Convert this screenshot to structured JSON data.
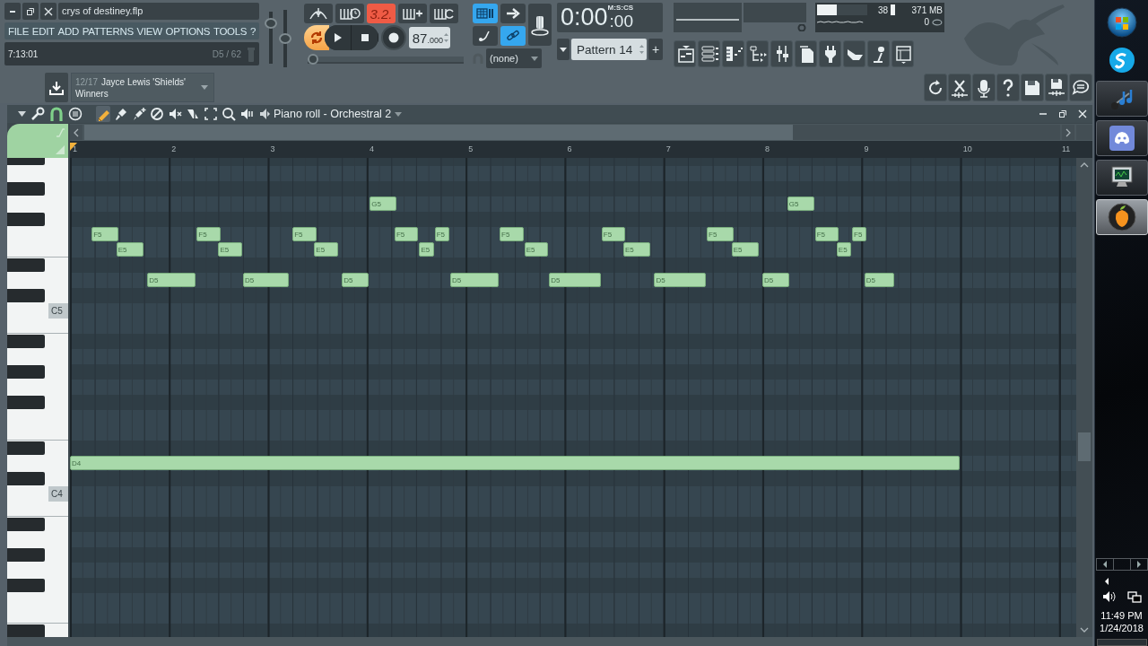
{
  "window": {
    "title": "crys of destiney.flp"
  },
  "menu": [
    "FILE",
    "EDIT",
    "ADD",
    "PATTERNS",
    "VIEW",
    "OPTIONS",
    "TOOLS",
    "?"
  ],
  "hint_bar": {
    "time": "7:13:01",
    "note": "D5 / 62"
  },
  "master": {
    "volume": {
      "level": 0.85
    },
    "pitch": {
      "level": 0.5
    }
  },
  "transport": {
    "countdown": "3.2.",
    "countdown_on": true,
    "loop_on": true,
    "tempo": "87",
    "tempo_fraction": ".000",
    "position": {
      "level": 0
    }
  },
  "snap_controls": {
    "step_edit_on": true,
    "link_on": true,
    "snap": "(none)"
  },
  "time_display": {
    "value": "0:00",
    "fraction": ":00",
    "format": "M:S:CS"
  },
  "pattern": {
    "name": "Pattern 14",
    "add": "+"
  },
  "monitor": {
    "cpu": "38",
    "cpu_meter": {
      "level": 0.4
    },
    "memory": "371 MB",
    "polyphony": "0"
  },
  "news": {
    "count": "12/17",
    "title": "Jayce Lewis 'Shields'",
    "subtitle": "Winners"
  },
  "piano_roll": {
    "title": "Piano roll - Orchestral 2",
    "snap_on": true,
    "tools": [
      {
        "selected": true
      },
      {
        "selected": false
      },
      {
        "selected": false
      },
      {
        "selected": false
      },
      {
        "selected": false
      },
      {
        "selected": false
      },
      {
        "selected": false
      },
      {
        "selected": false
      },
      {
        "selected": false
      }
    ],
    "bars": [
      "1",
      "2",
      "3",
      "4",
      "5",
      "6",
      "7",
      "8",
      "9",
      "10",
      "11"
    ],
    "key_labels": [
      "C5",
      "C4"
    ],
    "notes": [
      {
        "pitch": "F5"
      },
      {
        "pitch": "E5"
      },
      {
        "pitch": "D5"
      },
      {
        "pitch": "F5"
      },
      {
        "pitch": "E5"
      },
      {
        "pitch": "D5"
      },
      {
        "pitch": "F5"
      },
      {
        "pitch": "E5"
      },
      {
        "pitch": "D5"
      },
      {
        "pitch": "G5"
      },
      {
        "pitch": "F5"
      },
      {
        "pitch": "E5"
      },
      {
        "pitch": "F5"
      },
      {
        "pitch": "D5"
      },
      {
        "pitch": "F5"
      },
      {
        "pitch": "E5"
      },
      {
        "pitch": "D5"
      },
      {
        "pitch": "F5"
      },
      {
        "pitch": "E5"
      },
      {
        "pitch": "D5"
      },
      {
        "pitch": "F5"
      },
      {
        "pitch": "E5"
      },
      {
        "pitch": "D5"
      },
      {
        "pitch": "G5"
      },
      {
        "pitch": "F5"
      },
      {
        "pitch": "E5"
      },
      {
        "pitch": "F5"
      },
      {
        "pitch": "D5"
      },
      {
        "pitch": "D4"
      }
    ]
  },
  "taskbar": {
    "apps": [
      {
        "kind": "media",
        "selected": false
      },
      {
        "kind": "chat",
        "selected": false
      },
      {
        "kind": "monitor",
        "selected": false
      },
      {
        "kind": "daw",
        "selected": true
      }
    ],
    "clock": {
      "time": "11:49 PM",
      "date": "1/24/2018"
    }
  }
}
